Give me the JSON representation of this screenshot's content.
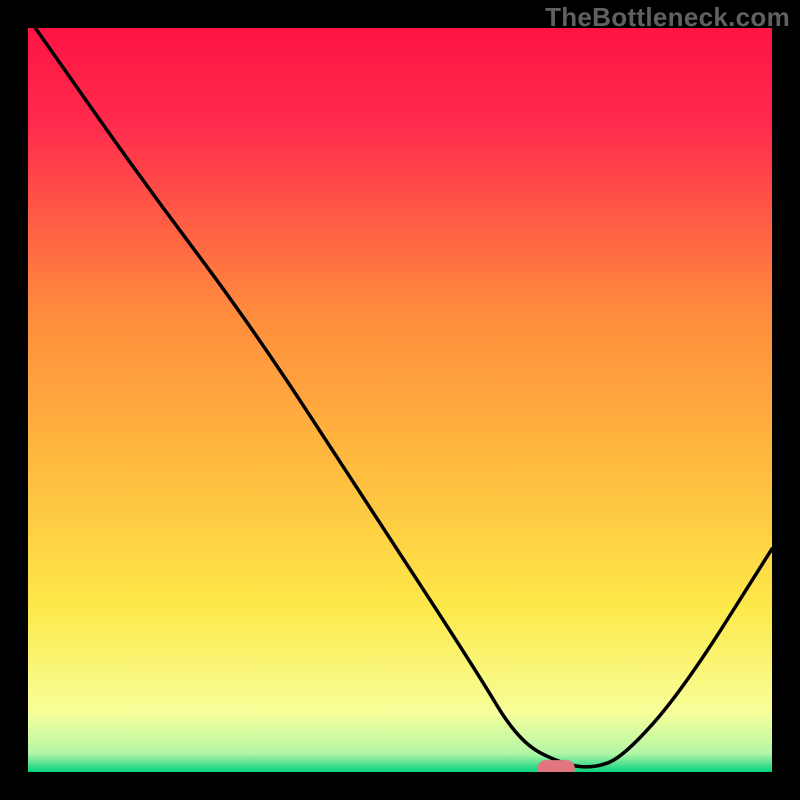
{
  "watermark": "TheBottleneck.com",
  "chart_data": {
    "type": "line",
    "title": "",
    "xlabel": "",
    "ylabel": "",
    "xlim": [
      0,
      100
    ],
    "ylim": [
      0,
      100
    ],
    "gradient_top_color": "#ff1444",
    "gradient_mid_color": "#ffee50",
    "gradient_bottom_color": "#06d27f",
    "series": [
      {
        "name": "curve",
        "x": [
          1,
          15,
          30,
          45,
          60,
          66,
          72,
          76,
          80,
          88,
          100
        ],
        "y": [
          100,
          80,
          60,
          37,
          14,
          4,
          1,
          0.5,
          2,
          11,
          30
        ]
      }
    ],
    "marker": {
      "x_percent": 71,
      "y_percent": 0.5,
      "width_percent": 5,
      "height_percent": 2.2,
      "color": "#e2767e"
    },
    "frame_color": "#000000"
  }
}
